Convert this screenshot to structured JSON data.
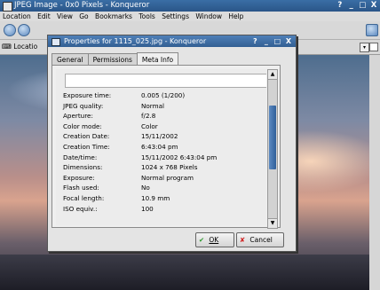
{
  "window": {
    "title": "JPEG Image - 0x0 Pixels - Konqueror",
    "controls": [
      "?",
      "_",
      "□",
      "X"
    ]
  },
  "menubar": [
    "Location",
    "Edit",
    "View",
    "Go",
    "Bookmarks",
    "Tools",
    "Settings",
    "Window",
    "Help"
  ],
  "location": {
    "label": "Locatio"
  },
  "dialog": {
    "title": "Properties for 1115_025.jpg - Konqueror",
    "controls": [
      "?",
      "_",
      "□",
      "X"
    ],
    "tabs": [
      "General",
      "Permissions",
      "Meta Info"
    ],
    "active_tab": "Meta Info",
    "fields": [
      {
        "key": "Exposure time:",
        "value": "0.005 (1/200)"
      },
      {
        "key": "JPEG quality:",
        "value": "Normal"
      },
      {
        "key": "Aperture:",
        "value": "f/2.8"
      },
      {
        "key": "Color mode:",
        "value": "Color"
      },
      {
        "key": "Creation Date:",
        "value": "15/11/2002"
      },
      {
        "key": "Creation Time:",
        "value": "6:43:04 pm"
      },
      {
        "key": "Date/time:",
        "value": "15/11/2002 6:43:04 pm"
      },
      {
        "key": "Dimensions:",
        "value": "1024 x 768 Pixels"
      },
      {
        "key": "Exposure:",
        "value": "Normal program"
      },
      {
        "key": "Flash used:",
        "value": "No"
      },
      {
        "key": "Focal length:",
        "value": "10.9 mm"
      },
      {
        "key": "ISO equiv.:",
        "value": "100"
      }
    ],
    "ok_label": "OK",
    "cancel_label": "Cancel"
  }
}
